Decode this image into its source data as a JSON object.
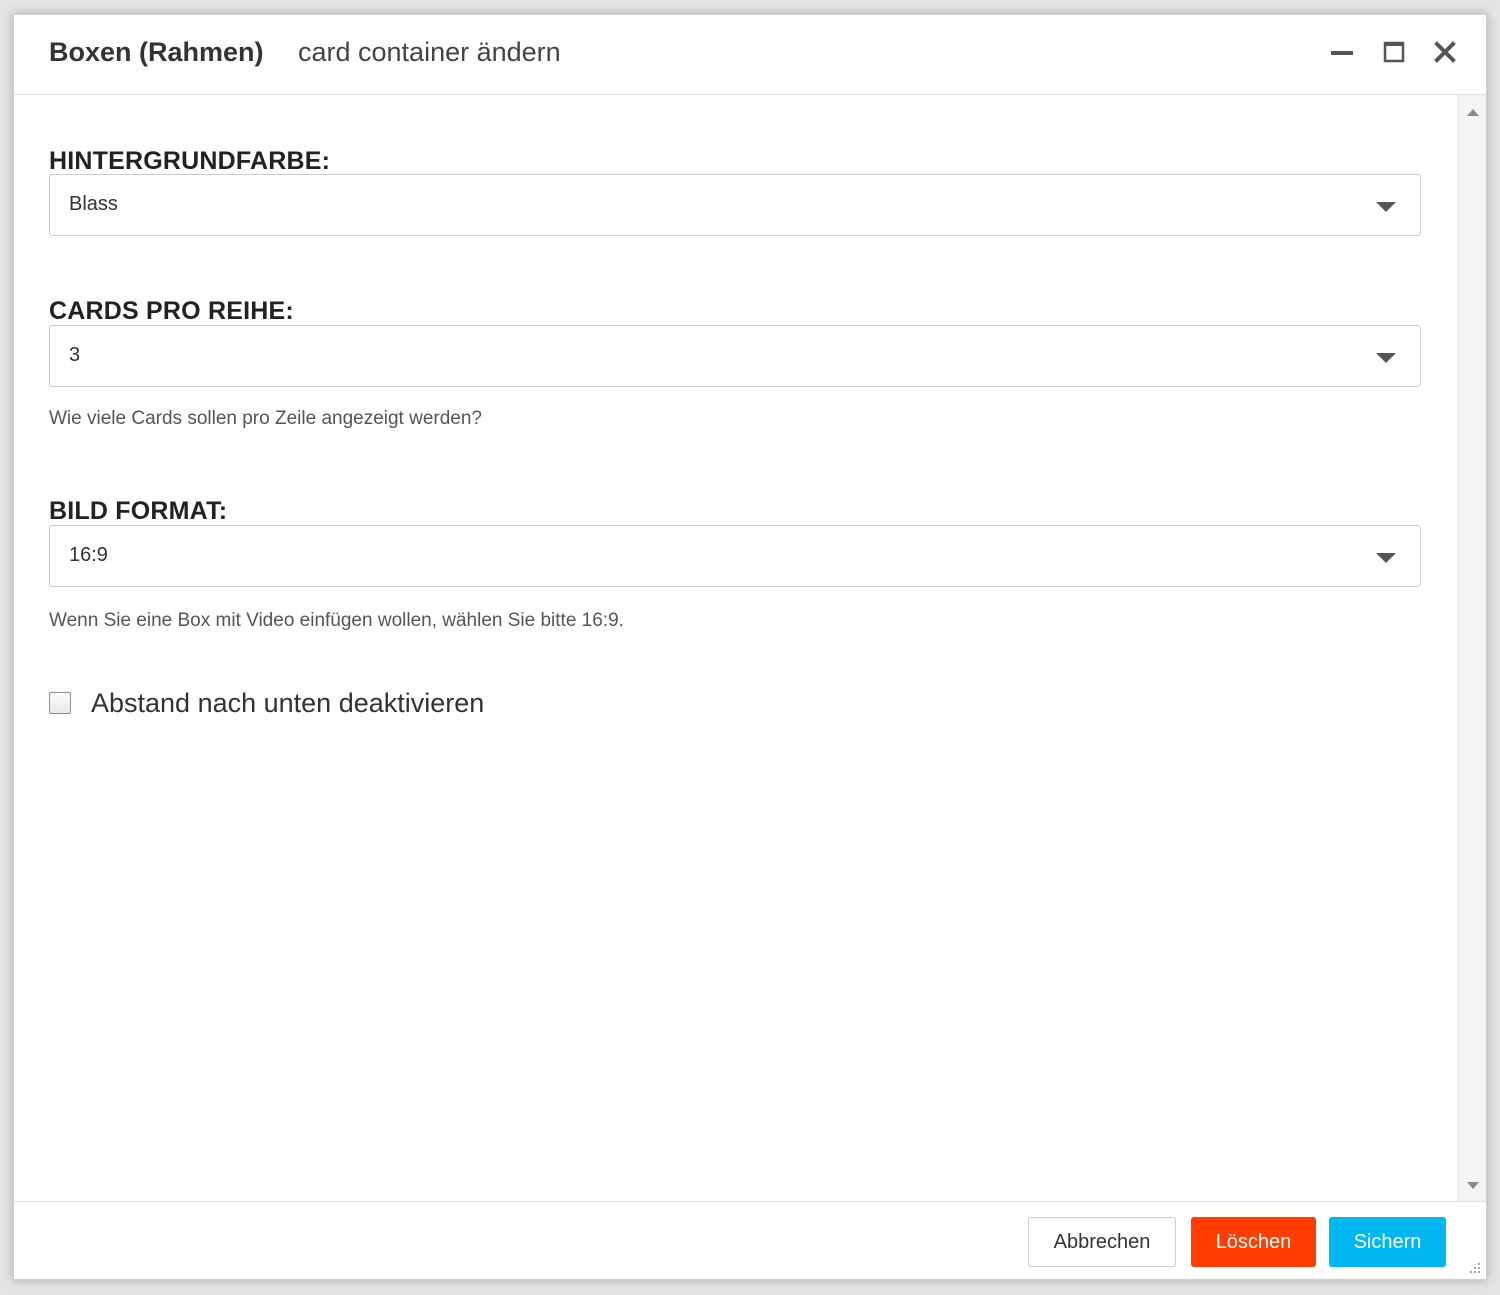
{
  "window": {
    "title": "Boxen (Rahmen)",
    "subtitle": "card container ändern",
    "controls": {
      "minimize_icon": "minimize-icon",
      "maximize_icon": "maximize-icon",
      "close_icon": "close-icon"
    }
  },
  "form": {
    "background_color": {
      "label": "HINTERGRUNDFARBE:",
      "value": "Blass"
    },
    "cards_per_row": {
      "label": "CARDS PRO REIHE:",
      "value": "3",
      "help": "Wie viele Cards sollen pro Zeile angezeigt werden?"
    },
    "image_format": {
      "label": "BILD FORMAT:",
      "value": "16:9",
      "help": "Wenn Sie eine Box mit Video einfügen wollen, wählen Sie bitte 16:9."
    },
    "disable_bottom_spacing": {
      "label": "Abstand nach unten deaktivieren",
      "checked": false
    }
  },
  "footer": {
    "cancel_label": "Abbrechen",
    "delete_label": "Löschen",
    "save_label": "Sichern"
  },
  "colors": {
    "delete": "#ff3d00",
    "save": "#00b7f1"
  }
}
